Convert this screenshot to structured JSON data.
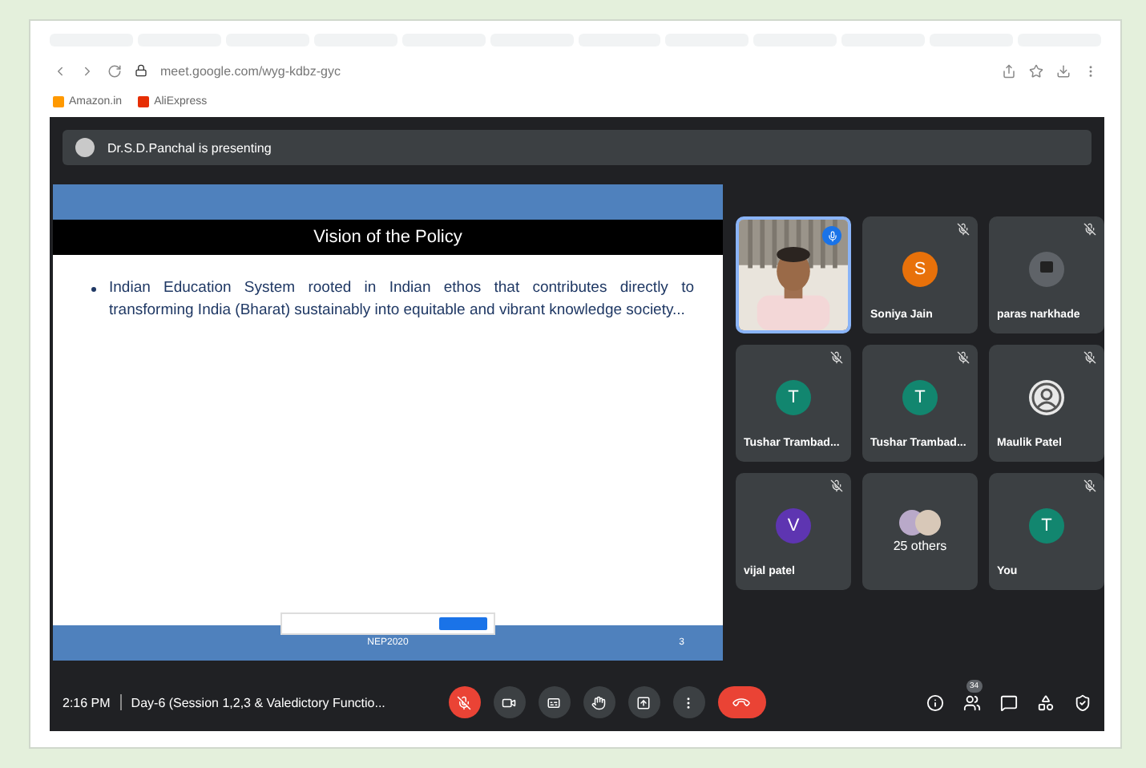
{
  "browser": {
    "url": "meet.google.com/wyg-kdbz-gyc",
    "bookmarks": [
      {
        "label": "Amazon.in",
        "color": "#ff9900"
      },
      {
        "label": "AliExpress",
        "color": "#e62e04"
      }
    ]
  },
  "presenting": {
    "text": "Dr.S.D.Panchal is presenting"
  },
  "slide": {
    "title": "Vision of the Policy",
    "bullets": [
      "Indian Education System rooted in Indian ethos that contributes directly to transforming India (Bharat) sustainably into equitable and vibrant knowledge society..."
    ],
    "footer": "NEP2020",
    "page": "3"
  },
  "tiles": [
    {
      "kind": "video",
      "muted": false,
      "speaking": true,
      "selected": true
    },
    {
      "kind": "avatar",
      "name": "Soniya Jain",
      "initial": "S",
      "color": "#e8710a",
      "muted": true,
      "speaking": false,
      "selected": false
    },
    {
      "name": "paras narkhade",
      "muted": true,
      "speaking": false,
      "selected": false
    },
    {
      "kind": "avatar",
      "name": "Tushar Trambad...",
      "initial": "T",
      "color": "#12866f",
      "muted": true,
      "speaking": false,
      "selected": false
    },
    {
      "kind": "avatar",
      "name": "Tushar Trambad...",
      "initial": "T",
      "color": "#12866f",
      "muted": true,
      "speaking": false,
      "selected": false
    },
    {
      "kind": "generic",
      "name": "Maulik Patel",
      "muted": true,
      "speaking": false,
      "selected": false
    },
    {
      "kind": "avatar",
      "name": "vijal patel",
      "initial": "V",
      "color": "#5e35b1",
      "muted": true,
      "speaking": false,
      "selected": false
    },
    {
      "kind": "others",
      "name": "25 others",
      "muted": false,
      "speaking": false,
      "selected": false
    },
    {
      "kind": "avatar",
      "name": "You",
      "initial": "T",
      "color": "#12866f",
      "muted": true,
      "speaking": false,
      "selected": false
    }
  ],
  "bottom_bar": {
    "time": "2:16 PM",
    "meeting": "Day-6 (Session 1,2,3 & Valedictory Functio...",
    "controls": [
      {
        "kind": "mic",
        "on": false
      },
      {
        "kind": "camera",
        "on": true
      },
      {
        "kind": "captions",
        "on": true
      },
      {
        "kind": "hand",
        "on": true
      },
      {
        "kind": "present",
        "on": true
      },
      {
        "kind": "more",
        "on": true
      },
      {
        "kind": "end"
      }
    ],
    "tools": [
      {
        "kind": "info"
      },
      {
        "kind": "people",
        "badge": "34"
      },
      {
        "kind": "chat"
      },
      {
        "kind": "activities"
      },
      {
        "kind": "lock"
      }
    ]
  }
}
